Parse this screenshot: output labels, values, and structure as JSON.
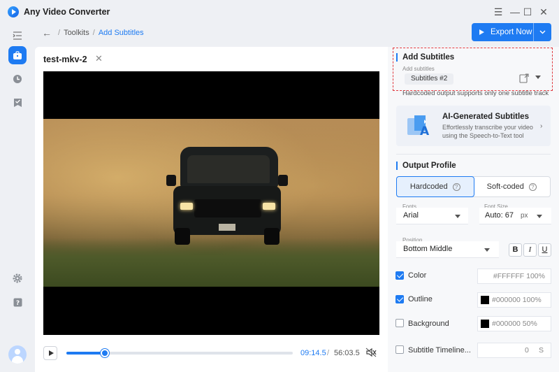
{
  "app": {
    "title": "Any Video Converter",
    "icon": "app-logo-icon"
  },
  "window_controls": {
    "menu": "☰",
    "minimize": "—",
    "maximize": "☐",
    "close": "✕"
  },
  "sidebar": {
    "items": [
      {
        "icon": "collapse-menu-icon"
      },
      {
        "icon": "toolbox-icon",
        "active": true
      },
      {
        "icon": "history-clock-icon"
      },
      {
        "icon": "bookmark-task-icon"
      },
      {
        "icon": "settings-gear-icon"
      },
      {
        "icon": "help-icon"
      }
    ],
    "avatar": "user-avatar"
  },
  "breadcrumb": {
    "parent": "Toolkits",
    "separator": "/",
    "current": "Add Subtitles"
  },
  "toolbar": {
    "export_label": "Export Now"
  },
  "player": {
    "file_name": "test-mkv-2",
    "progress": 0.17,
    "current_time": "09:14.5",
    "time_separator": "/",
    "total_time": "56:03.5"
  },
  "subtitles_panel": {
    "title": "Add Subtitles",
    "field_label": "Add subtitles",
    "selected": "Subtitles #2",
    "hint": "Hardcoded output supports only one subtitle track"
  },
  "ai_card": {
    "title": "AI-Generated Subtitles",
    "description": "Effortlessly transcribe your video using the Speech-to-Text tool"
  },
  "output_profile": {
    "title": "Output Profile",
    "modes": [
      "Hardcoded",
      "Soft-coded"
    ],
    "active_mode": "Hardcoded",
    "fonts_label": "Fonts",
    "font_value": "Arial",
    "font_size_label": "Font Size",
    "font_size_value": "Auto: 67",
    "font_size_unit": "px",
    "position_label": "Position",
    "position_value": "Bottom Middle",
    "style_buttons": [
      "B",
      "I",
      "U"
    ],
    "options": [
      {
        "label": "Color",
        "checked": true,
        "value": "#FFFFFF 100%"
      },
      {
        "label": "Outline",
        "checked": true,
        "value": "#000000 100%"
      },
      {
        "label": "Background",
        "checked": false,
        "value": "#000000 50%"
      },
      {
        "label": "Subtitle Timeline...",
        "checked": false,
        "value": "0",
        "unit": "S"
      }
    ]
  },
  "colors": {
    "accent": "#1e7bf2",
    "highlight_border": "#e0383e"
  }
}
